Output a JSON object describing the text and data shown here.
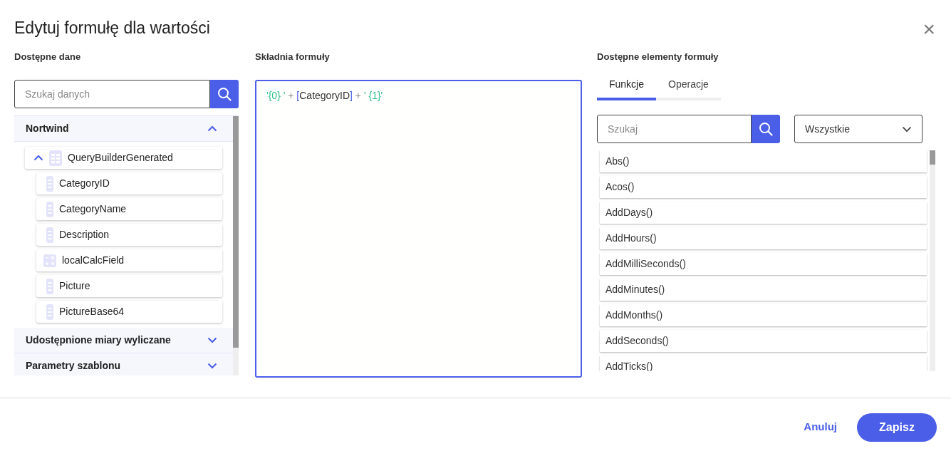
{
  "dialog": {
    "title": "Edytuj formułę dla wartości",
    "close": "×"
  },
  "data_panel": {
    "heading": "Dostępne dane",
    "search": {
      "placeholder": "Szukaj danych"
    },
    "sections": [
      {
        "label": "Nortwind",
        "expanded": true,
        "children": [
          {
            "label": "QueryBuilderGenerated",
            "kind": "table",
            "expanded": true,
            "children": [
              {
                "label": "CategoryID",
                "kind": "field"
              },
              {
                "label": "CategoryName",
                "kind": "field"
              },
              {
                "label": "Description",
                "kind": "field"
              },
              {
                "label": "localCalcField",
                "kind": "calc"
              },
              {
                "label": "Picture",
                "kind": "field"
              },
              {
                "label": "PictureBase64",
                "kind": "field"
              }
            ]
          }
        ]
      },
      {
        "label": "Udostępnione miary wyliczane",
        "expanded": false
      },
      {
        "label": "Parametry szablonu",
        "expanded": false
      }
    ]
  },
  "formula_panel": {
    "heading": "Składnia formuły",
    "tokens": [
      {
        "text": "'{0} '",
        "kind": "string"
      },
      {
        "text": " + ",
        "kind": "operator"
      },
      {
        "text": "[",
        "kind": "bracket"
      },
      {
        "text": "CategoryID",
        "kind": "field"
      },
      {
        "text": "]",
        "kind": "bracket"
      },
      {
        "text": " + ",
        "kind": "operator"
      },
      {
        "text": "' {1}'",
        "kind": "string"
      }
    ]
  },
  "elements_panel": {
    "heading": "Dostępne elementy formuły",
    "tabs": [
      {
        "label": "Funkcje",
        "selected": true
      },
      {
        "label": "Operacje",
        "selected": false
      }
    ],
    "search": {
      "placeholder": "Szukaj"
    },
    "filter": {
      "value": "Wszystkie"
    },
    "items": [
      "Abs()",
      "Acos()",
      "AddDays()",
      "AddHours()",
      "AddMilliSeconds()",
      "AddMinutes()",
      "AddMonths()",
      "AddSeconds()",
      "AddTicks()"
    ]
  },
  "buttons": [
    {
      "label": "Anuluj",
      "kind": "secondary"
    },
    {
      "label": "Zapisz",
      "kind": "primary"
    }
  ]
}
